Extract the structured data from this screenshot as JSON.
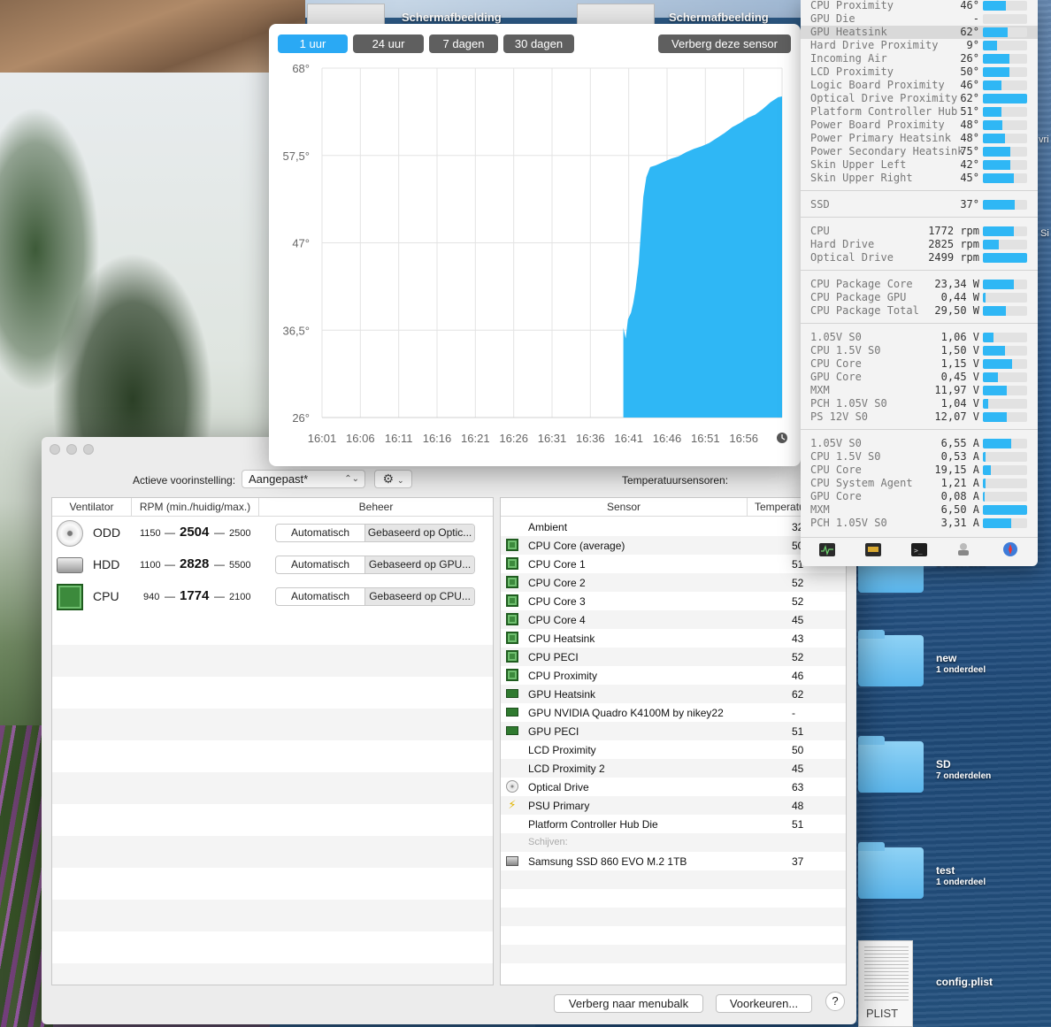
{
  "desktop": {
    "thumb_labels": [
      "Schermafbeelding",
      "Schermafbeelding"
    ],
    "folders": [
      {
        "name": "",
        "sub": "1 onderdeel"
      },
      {
        "name": "new",
        "sub": "1 onderdeel"
      },
      {
        "name": "SD",
        "sub": "7 onderdelen"
      },
      {
        "name": "test",
        "sub": "1 onderdeel"
      }
    ],
    "file": {
      "name": "config.plist",
      "ext": "PLIST"
    },
    "edge_fragments": [
      "vri",
      "Si"
    ]
  },
  "chart_popover": {
    "ranges": [
      "1 uur",
      "24 uur",
      "7 dagen",
      "30 dagen"
    ],
    "active_range": "1 uur",
    "hide_sensor_label": "Verberg deze sensor",
    "clock_icon": "clock-icon"
  },
  "chart_data": {
    "type": "area",
    "title": "",
    "xlabel": "",
    "ylabel": "",
    "x_ticks": [
      "16:01",
      "16:06",
      "16:11",
      "16:16",
      "16:21",
      "16:26",
      "16:31",
      "16:36",
      "16:41",
      "16:46",
      "16:51",
      "16:56"
    ],
    "y_ticks": [
      "68°",
      "57,5°",
      "47°",
      "36,5°",
      "26°"
    ],
    "ylim": [
      26,
      68
    ],
    "xlim_minutes": [
      0,
      60
    ],
    "grid": true,
    "color": "#2fb7f5",
    "series": [
      {
        "points": [
          [
            39.3,
            26
          ],
          [
            39.3,
            36.8
          ],
          [
            39.6,
            35.5
          ],
          [
            39.9,
            37.8
          ],
          [
            40.3,
            38.6
          ],
          [
            40.6,
            39.8
          ],
          [
            40.9,
            41.5
          ],
          [
            41.3,
            44.5
          ],
          [
            41.6,
            48.5
          ],
          [
            41.9,
            52.5
          ],
          [
            42.3,
            54.9
          ],
          [
            42.8,
            56.1
          ],
          [
            43.5,
            56.3
          ],
          [
            44.5,
            56.7
          ],
          [
            45.5,
            57.1
          ],
          [
            46.5,
            57.4
          ],
          [
            47.5,
            57.9
          ],
          [
            48.5,
            58.3
          ],
          [
            49.5,
            58.6
          ],
          [
            50.5,
            59.0
          ],
          [
            51.5,
            59.6
          ],
          [
            52.5,
            60.2
          ],
          [
            53.5,
            60.9
          ],
          [
            54.5,
            61.4
          ],
          [
            55.5,
            62.0
          ],
          [
            56.5,
            62.4
          ],
          [
            57.5,
            63.1
          ],
          [
            58.5,
            63.9
          ],
          [
            59.5,
            64.5
          ],
          [
            60,
            64.6
          ],
          [
            60,
            26
          ]
        ]
      }
    ]
  },
  "sensor_menu": {
    "temps": [
      {
        "name": "CPU Proximity",
        "value": "46°",
        "fill": 0.52
      },
      {
        "name": "GPU Die",
        "value": "-",
        "fill": 0
      },
      {
        "name": "GPU Heatsink",
        "value": "62°",
        "fill": 0.56,
        "highlight": true
      },
      {
        "name": "Hard Drive Proximity",
        "value": "9°",
        "fill": 0.32
      },
      {
        "name": "Incoming Air",
        "value": "26°",
        "fill": 0.6
      },
      {
        "name": "LCD Proximity",
        "value": "50°",
        "fill": 0.6
      },
      {
        "name": "Logic Board Proximity",
        "value": "46°",
        "fill": 0.42
      },
      {
        "name": "Optical Drive Proximity",
        "value": "62°",
        "fill": 1.0
      },
      {
        "name": "Platform Controller Hub",
        "value": "51°",
        "fill": 0.42
      },
      {
        "name": "Power Board Proximity",
        "value": "48°",
        "fill": 0.44
      },
      {
        "name": "Power Primary Heatsink",
        "value": "48°",
        "fill": 0.5
      },
      {
        "name": "Power Secondary Heatsink",
        "value": "75°",
        "fill": 0.62
      },
      {
        "name": "Skin Upper Left",
        "value": "42°",
        "fill": 0.62
      },
      {
        "name": "Skin Upper Right",
        "value": "45°",
        "fill": 0.7
      }
    ],
    "ssd": [
      {
        "name": "SSD",
        "value": "37°",
        "fill": 0.72
      }
    ],
    "fans": [
      {
        "name": "CPU",
        "value": "1772 rpm",
        "fill": 0.7
      },
      {
        "name": "Hard Drive",
        "value": "2825 rpm",
        "fill": 0.36
      },
      {
        "name": "Optical Drive",
        "value": "2499 rpm",
        "fill": 1.0
      }
    ],
    "power": [
      {
        "name": "CPU Package Core",
        "value": "23,34 W",
        "fill": 0.7
      },
      {
        "name": "CPU Package GPU",
        "value": "0,44 W",
        "fill": 0.06
      },
      {
        "name": "CPU Package Total",
        "value": "29,50 W",
        "fill": 0.52
      }
    ],
    "voltage": [
      {
        "name": "1.05V S0",
        "value": "1,06 V",
        "fill": 0.24
      },
      {
        "name": "CPU 1.5V S0",
        "value": "1,50 V",
        "fill": 0.5
      },
      {
        "name": "CPU Core",
        "value": "1,15 V",
        "fill": 0.66
      },
      {
        "name": "GPU Core",
        "value": "0,45 V",
        "fill": 0.34
      },
      {
        "name": "MXM",
        "value": "11,97 V",
        "fill": 0.54
      },
      {
        "name": "PCH 1.05V S0",
        "value": "1,04 V",
        "fill": 0.12
      },
      {
        "name": "PS 12V S0",
        "value": "12,07 V",
        "fill": 0.54
      }
    ],
    "current": [
      {
        "name": "1.05V S0",
        "value": "6,55 A",
        "fill": 0.64
      },
      {
        "name": "CPU 1.5V S0",
        "value": "0,53 A",
        "fill": 0.06
      },
      {
        "name": "CPU Core",
        "value": "19,15 A",
        "fill": 0.18
      },
      {
        "name": "CPU System Agent",
        "value": "1,21 A",
        "fill": 0.06
      },
      {
        "name": "GPU Core",
        "value": "0,08 A",
        "fill": 0.04
      },
      {
        "name": "MXM",
        "value": "6,50 A",
        "fill": 1.0
      },
      {
        "name": "PCH 1.05V S0",
        "value": "3,31 A",
        "fill": 0.64
      }
    ],
    "toolbar_icons": [
      "activity-monitor-icon",
      "hardware-monitor-icon",
      "terminal-icon",
      "system-info-icon",
      "safari-icon"
    ]
  },
  "app_window": {
    "preset_label": "Actieve voorinstelling:",
    "preset_value": "Aangepast*",
    "gear_icon": "gear-icon",
    "temp_sensors_label": "Temperatuursensoren:",
    "fan_headers": [
      "Ventilator",
      "RPM (min./huidig/max.)",
      "Beheer"
    ],
    "fans": [
      {
        "name": "ODD",
        "min": "1150",
        "cur": "2504",
        "max": "2500",
        "mode_auto": "Automatisch",
        "mode_based": "Gebaseerd op Optic...",
        "icon": "optical-drive-icon"
      },
      {
        "name": "HDD",
        "min": "1100",
        "cur": "2828",
        "max": "5500",
        "mode_auto": "Automatisch",
        "mode_based": "Gebaseerd op GPU...",
        "icon": "hard-drive-icon"
      },
      {
        "name": "CPU",
        "min": "940",
        "cur": "1774",
        "max": "2100",
        "mode_auto": "Automatisch",
        "mode_based": "Gebaseerd op CPU...",
        "icon": "cpu-chip-icon"
      }
    ],
    "fan_dash": "—",
    "sensor_headers": [
      "Sensor",
      "Temperatu"
    ],
    "sensors": [
      {
        "name": "Ambient",
        "value": "32",
        "icon": "none"
      },
      {
        "name": "CPU Core (average)",
        "value": "50",
        "icon": "chip"
      },
      {
        "name": "CPU Core 1",
        "value": "51",
        "icon": "chip"
      },
      {
        "name": "CPU Core 2",
        "value": "52",
        "icon": "chip"
      },
      {
        "name": "CPU Core 3",
        "value": "52",
        "icon": "chip"
      },
      {
        "name": "CPU Core 4",
        "value": "45",
        "icon": "chip"
      },
      {
        "name": "CPU Heatsink",
        "value": "43",
        "icon": "chip"
      },
      {
        "name": "CPU PECI",
        "value": "52",
        "icon": "chip"
      },
      {
        "name": "CPU Proximity",
        "value": "46",
        "icon": "chip"
      },
      {
        "name": "GPU Heatsink",
        "value": "62",
        "icon": "gpu"
      },
      {
        "name": "GPU NVIDIA Quadro K4100M by nikey22",
        "value": "-",
        "icon": "gpu"
      },
      {
        "name": "GPU PECI",
        "value": "51",
        "icon": "gpu"
      },
      {
        "name": "LCD Proximity",
        "value": "50",
        "icon": "none"
      },
      {
        "name": "LCD Proximity 2",
        "value": "45",
        "icon": "none"
      },
      {
        "name": "Optical Drive",
        "value": "63",
        "icon": "disc"
      },
      {
        "name": "PSU Primary",
        "value": "48",
        "icon": "bolt"
      },
      {
        "name": "Platform Controller Hub Die",
        "value": "51",
        "icon": "none"
      },
      {
        "name": "Schijven:",
        "value": "",
        "icon": "group"
      },
      {
        "name": "Samsung SSD 860 EVO M.2 1TB",
        "value": "37",
        "icon": "ssd"
      }
    ],
    "hide_menubar_label": "Verberg naar menubalk",
    "preferences_label": "Voorkeuren...",
    "help_label": "?"
  }
}
